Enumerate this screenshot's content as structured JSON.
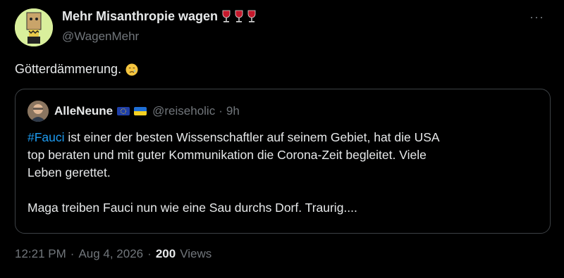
{
  "author": {
    "display_name": "Mehr Misanthropie wagen",
    "emoji_icons": [
      "wine-glass-icon",
      "wine-glass-icon",
      "wine-glass-icon"
    ],
    "handle": "@WagenMehr"
  },
  "tweet": {
    "text": "Götterdämmerung.",
    "emoji_icon": "crying-face-icon"
  },
  "more_label": "···",
  "quoted": {
    "display_name": "AlleNeune",
    "flag_icons": [
      "eu-flag-icon",
      "ukraine-flag-icon"
    ],
    "handle": "@reiseholic",
    "separator": "·",
    "time": "9h",
    "hashtag": "#Fauci",
    "line1_rest": " ist einer der besten Wissenschaftler auf seinem Gebiet, hat die USA",
    "line2": "top beraten und mit guter Kommunikation die Corona-Zeit begleitet. Viele",
    "line3": "Leben gerettet.",
    "line4": "Maga treiben Fauci nun wie eine Sau durchs Dorf. Traurig...."
  },
  "meta": {
    "time": "12:21 PM",
    "separator": "·",
    "date": "Aug 4, 2026",
    "views_count": "200",
    "views_label": "Views"
  },
  "colors": {
    "background": "#000000",
    "text": "#e7e9ea",
    "muted": "#71767b",
    "link": "#1d9bf0",
    "border": "#3d4145"
  }
}
